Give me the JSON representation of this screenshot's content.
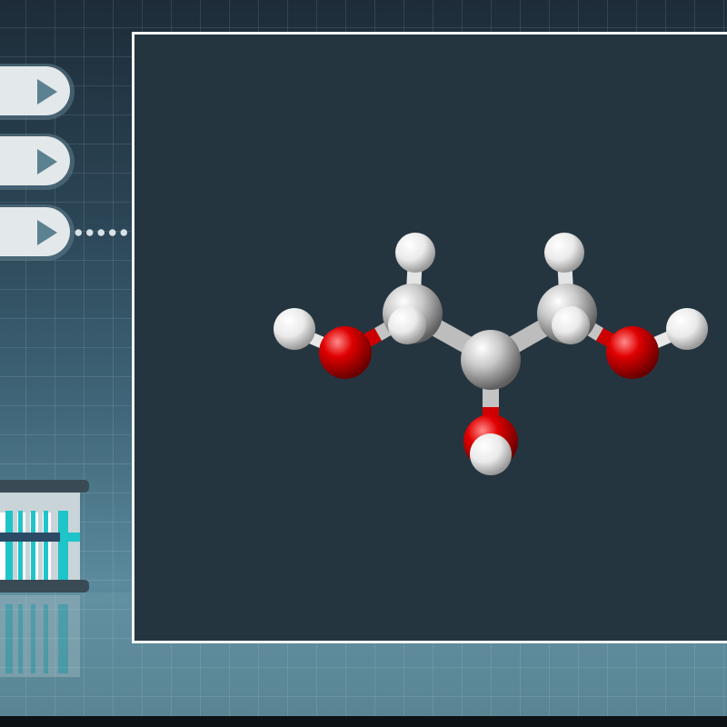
{
  "scene": {
    "menu_buttons": [
      {
        "icon": "play-icon"
      },
      {
        "icon": "play-icon"
      },
      {
        "icon": "play-icon"
      }
    ],
    "connector": "dotted-line",
    "viewer": {
      "content": "ball-and-stick-molecule",
      "atoms": [
        {
          "element": "C",
          "color": "#c8c8c8"
        },
        {
          "element": "C",
          "color": "#c8c8c8"
        },
        {
          "element": "C",
          "color": "#c8c8c8"
        },
        {
          "element": "O",
          "color": "#e00000"
        },
        {
          "element": "O",
          "color": "#e00000"
        },
        {
          "element": "O",
          "color": "#e00000"
        },
        {
          "element": "H",
          "color": "#eeeeee"
        },
        {
          "element": "H",
          "color": "#eeeeee"
        },
        {
          "element": "H",
          "color": "#eeeeee"
        },
        {
          "element": "H",
          "color": "#eeeeee"
        },
        {
          "element": "H",
          "color": "#eeeeee"
        },
        {
          "element": "H",
          "color": "#eeeeee"
        },
        {
          "element": "H",
          "color": "#eeeeee"
        },
        {
          "element": "H",
          "color": "#eeeeee"
        }
      ]
    },
    "decoration": "test-tube-rack-icon"
  },
  "colors": {
    "viewer_background": "#253540",
    "viewer_border": "#f1f3f4",
    "button_fill": "#e3e8ea",
    "button_icon": "#5c8191",
    "carbon": "#c8c8c8",
    "oxygen": "#e00000",
    "hydrogen": "#eeeeee",
    "rack_accent": "#1fc4c8"
  }
}
